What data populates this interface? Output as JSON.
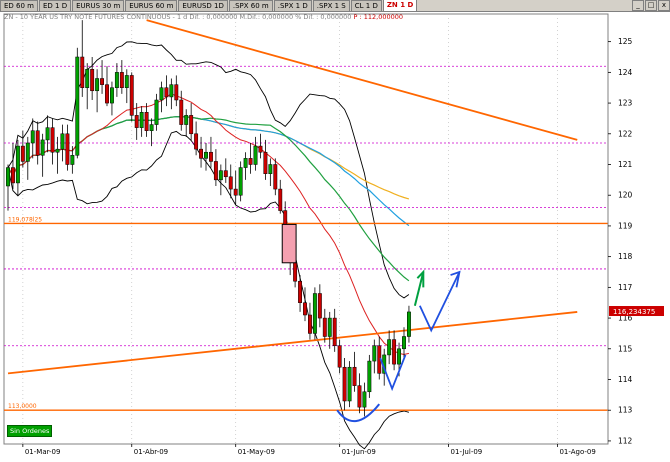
{
  "tabs": [
    {
      "label": "ED 60 m",
      "active": false
    },
    {
      "label": "ED 1 D",
      "active": false
    },
    {
      "label": "EURUS 30 m",
      "active": false
    },
    {
      "label": "EURUS 60 m",
      "active": false
    },
    {
      "label": "EURUSD 1D",
      "active": false
    },
    {
      "label": ".SPX 60 m",
      "active": false
    },
    {
      "label": ".SPX 1 D",
      "active": false
    },
    {
      "label": ".SPX 1 S",
      "active": false
    },
    {
      "label": "CL 1 D",
      "active": false
    },
    {
      "label": "ZN 1 D",
      "active": true
    }
  ],
  "window_buttons": {
    "minimize": "_",
    "maximize": "□",
    "close": "x"
  },
  "legend": {
    "symbol": "ZN - 10 YEAR US TRY NOTE FUTURES CONTINUOUS - 1 d Dif. : 0,000000 M.Dif.: 0,000000 % Dif. : 0,000000",
    "price": "P : 112,000000"
  },
  "order_status": "Sin Ordenes",
  "colors": {
    "bull": "#00a000",
    "bear": "#cc0000",
    "bollinger": "#000000",
    "ma_red": "#dd2222",
    "ma_green": "#20a040",
    "ma_blue": "#20a0e0",
    "ma_orange": "#f0b020",
    "trendline": "#ff6600",
    "level": "#ff6600",
    "dotted_level": "#cc00cc",
    "price_tag": "#cc0000",
    "annotation_blue": "#2050e0",
    "annotation_green": "#00a040"
  },
  "chart_data": {
    "type": "candlestick",
    "ylim": [
      111.9,
      125.9
    ],
    "y_ticks": [
      112,
      113,
      114,
      115,
      116,
      117,
      118,
      119,
      120,
      121,
      122,
      123,
      124,
      125
    ],
    "x_labels": [
      {
        "i": 3,
        "label": "01-Mar-09"
      },
      {
        "i": 25,
        "label": "01-Abr-09"
      },
      {
        "i": 46,
        "label": "01-May-09"
      },
      {
        "i": 67,
        "label": "01-Jun-09"
      },
      {
        "i": 89,
        "label": "01-Jul-09"
      },
      {
        "i": 111,
        "label": "01-Ago-09"
      }
    ],
    "last_price_label": "116,234375",
    "last_price": 116.23,
    "level_labels": [
      {
        "label": "119,078l25",
        "value": 119.08
      },
      {
        "label": "113,0000",
        "value": 113.0
      }
    ],
    "horizontal_levels": [
      119.08,
      113.0
    ],
    "dotted_levels": [
      124.2,
      121.7,
      119.6,
      117.6,
      115.1
    ],
    "trendlines": [
      {
        "from": [
          28,
          125.7
        ],
        "to": [
          115,
          121.8
        ]
      },
      {
        "from": [
          0,
          114.2
        ],
        "to": [
          115,
          116.2
        ]
      }
    ],
    "bars": [
      [
        120.3,
        121.0,
        119.5,
        120.9
      ],
      [
        120.9,
        121.7,
        120.2,
        120.4
      ],
      [
        120.4,
        121.8,
        120.0,
        121.6
      ],
      [
        121.6,
        122.1,
        120.9,
        121.1
      ],
      [
        121.1,
        121.9,
        120.5,
        121.7
      ],
      [
        121.7,
        122.5,
        121.2,
        122.1
      ],
      [
        122.1,
        122.4,
        121.0,
        121.3
      ],
      [
        121.3,
        122.0,
        120.6,
        121.8
      ],
      [
        121.8,
        122.6,
        121.4,
        122.2
      ],
      [
        122.2,
        122.5,
        121.0,
        121.4
      ],
      [
        121.4,
        121.9,
        120.7,
        121.5
      ],
      [
        121.5,
        122.3,
        121.1,
        122.0
      ],
      [
        122.0,
        122.3,
        120.8,
        121.0
      ],
      [
        121.0,
        121.6,
        120.7,
        121.3
      ],
      [
        121.3,
        124.8,
        121.2,
        124.5
      ],
      [
        124.5,
        125.7,
        123.2,
        123.5
      ],
      [
        123.5,
        124.3,
        122.8,
        124.1
      ],
      [
        124.1,
        124.5,
        123.1,
        123.4
      ],
      [
        123.4,
        124.1,
        122.7,
        123.8
      ],
      [
        123.8,
        124.4,
        123.3,
        123.6
      ],
      [
        123.6,
        124.2,
        122.9,
        123.0
      ],
      [
        123.0,
        123.7,
        122.6,
        123.5
      ],
      [
        123.5,
        124.3,
        123.2,
        124.0
      ],
      [
        124.0,
        124.4,
        123.3,
        123.5
      ],
      [
        123.5,
        124.1,
        123.0,
        123.9
      ],
      [
        123.9,
        124.0,
        122.4,
        122.6
      ],
      [
        122.6,
        123.0,
        121.8,
        122.2
      ],
      [
        122.2,
        122.9,
        121.9,
        122.7
      ],
      [
        122.7,
        123.0,
        121.9,
        122.1
      ],
      [
        122.1,
        122.5,
        121.6,
        122.3
      ],
      [
        122.3,
        123.3,
        122.1,
        123.1
      ],
      [
        123.1,
        123.7,
        122.7,
        123.5
      ],
      [
        123.5,
        123.9,
        122.9,
        123.2
      ],
      [
        123.2,
        123.8,
        122.8,
        123.6
      ],
      [
        123.6,
        123.9,
        122.9,
        123.1
      ],
      [
        123.1,
        123.4,
        122.1,
        122.3
      ],
      [
        122.3,
        122.8,
        121.9,
        122.6
      ],
      [
        122.6,
        123.0,
        121.8,
        122.0
      ],
      [
        122.0,
        122.4,
        121.3,
        121.5
      ],
      [
        121.5,
        121.9,
        120.9,
        121.2
      ],
      [
        121.2,
        121.7,
        120.8,
        121.4
      ],
      [
        121.4,
        121.9,
        120.9,
        121.1
      ],
      [
        121.1,
        121.5,
        120.3,
        120.5
      ],
      [
        120.5,
        121.0,
        120.0,
        120.8
      ],
      [
        120.8,
        121.2,
        120.4,
        120.6
      ],
      [
        120.6,
        121.0,
        119.9,
        120.2
      ],
      [
        120.2,
        120.8,
        119.7,
        120.0
      ],
      [
        120.0,
        121.1,
        119.8,
        120.9
      ],
      [
        120.9,
        121.4,
        120.5,
        121.2
      ],
      [
        121.2,
        121.7,
        120.7,
        121.0
      ],
      [
        121.0,
        121.9,
        120.8,
        121.6
      ],
      [
        121.6,
        122.0,
        121.2,
        121.4
      ],
      [
        121.4,
        121.8,
        120.5,
        120.7
      ],
      [
        120.7,
        121.2,
        120.3,
        121.0
      ],
      [
        121.0,
        121.2,
        120.0,
        120.2
      ],
      [
        120.2,
        120.5,
        119.4,
        119.5
      ],
      [
        119.5,
        119.8,
        118.7,
        118.9
      ],
      [
        118.9,
        119.0,
        117.4,
        117.8
      ],
      [
        117.8,
        118.1,
        117.0,
        117.2
      ],
      [
        117.2,
        117.4,
        116.2,
        116.5
      ],
      [
        116.5,
        117.0,
        115.9,
        116.1
      ],
      [
        116.1,
        116.5,
        115.3,
        115.5
      ],
      [
        115.5,
        117.0,
        115.3,
        116.8
      ],
      [
        116.8,
        117.1,
        115.7,
        116.0
      ],
      [
        116.0,
        116.3,
        115.2,
        115.4
      ],
      [
        115.4,
        116.2,
        115.0,
        116.0
      ],
      [
        116.0,
        116.3,
        114.9,
        115.1
      ],
      [
        115.1,
        115.3,
        114.2,
        114.4
      ],
      [
        114.4,
        114.7,
        113.0,
        113.3
      ],
      [
        113.3,
        114.6,
        113.1,
        114.4
      ],
      [
        114.4,
        114.9,
        113.6,
        113.8
      ],
      [
        113.8,
        114.2,
        112.9,
        113.1
      ],
      [
        113.1,
        113.9,
        112.8,
        113.6
      ],
      [
        113.6,
        114.8,
        113.4,
        114.6
      ],
      [
        114.6,
        115.3,
        114.2,
        115.1
      ],
      [
        115.1,
        115.4,
        114.0,
        114.2
      ],
      [
        114.2,
        115.0,
        113.8,
        114.8
      ],
      [
        114.8,
        115.6,
        114.5,
        115.3
      ],
      [
        115.3,
        115.6,
        114.3,
        114.5
      ],
      [
        114.5,
        115.2,
        114.1,
        115.0
      ],
      [
        115.0,
        115.7,
        114.7,
        115.4
      ],
      [
        115.4,
        116.4,
        115.2,
        116.2
      ]
    ]
  }
}
